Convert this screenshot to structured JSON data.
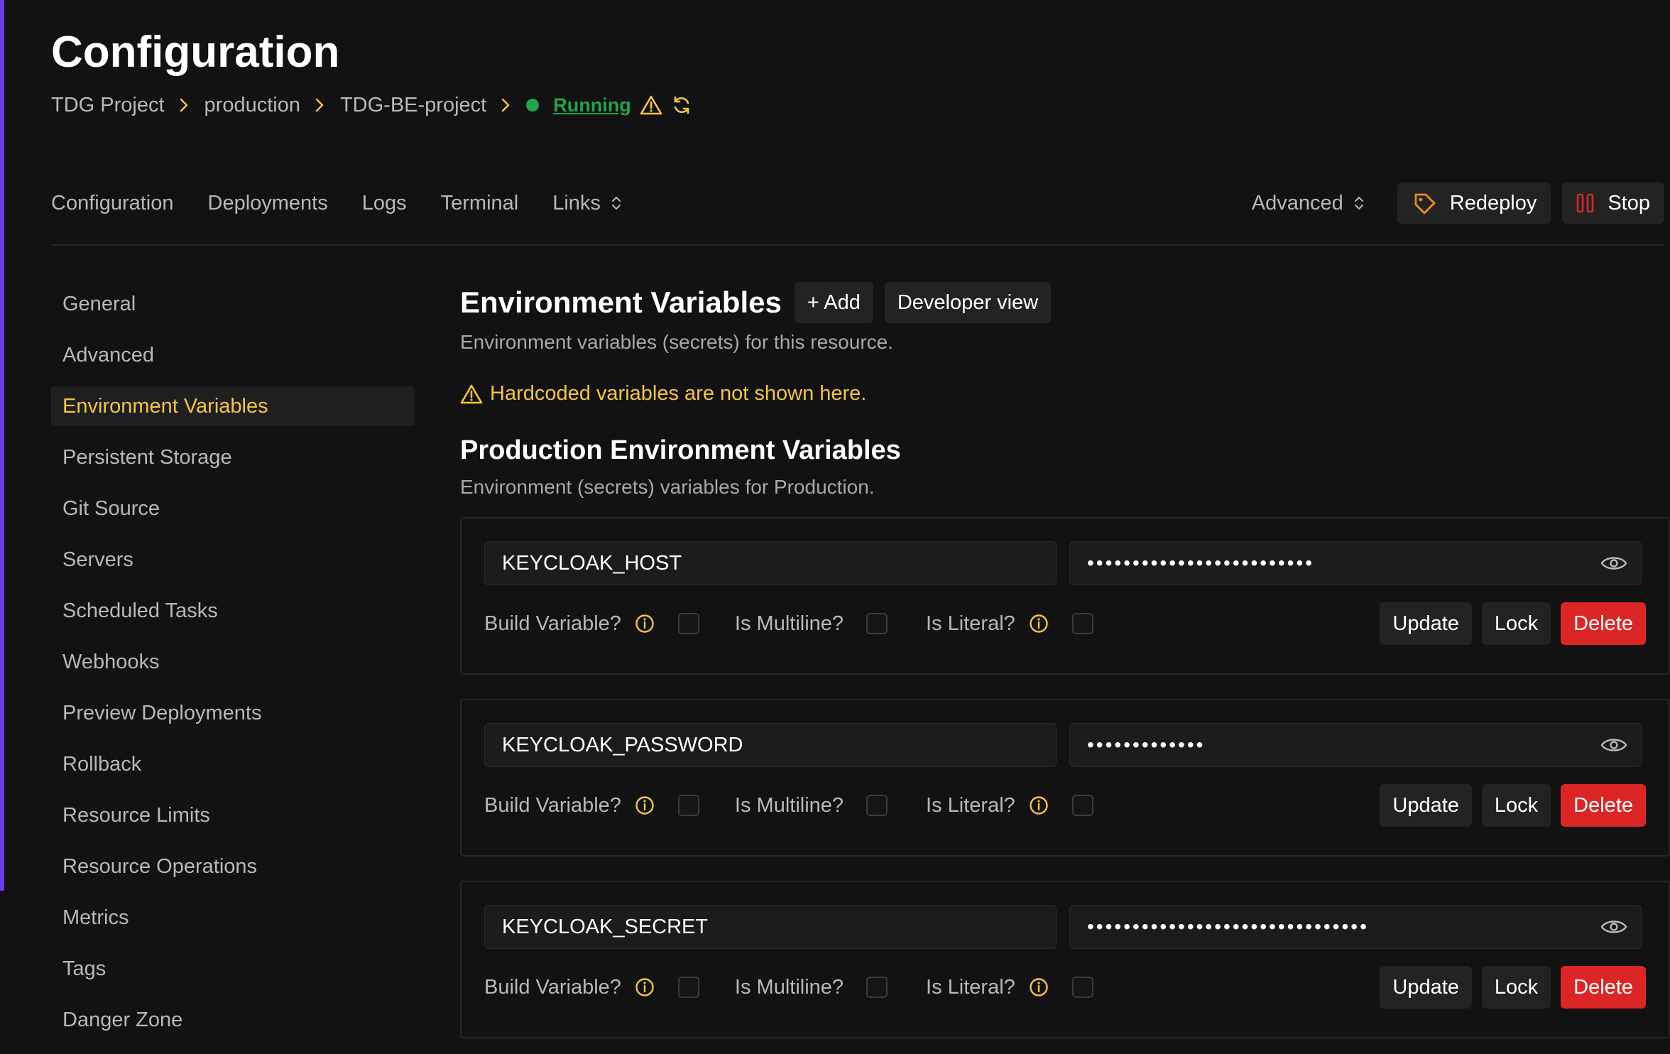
{
  "page": {
    "title": "Configuration",
    "breadcrumb": [
      "TDG Project",
      "production",
      "TDG-BE-project"
    ],
    "status": "Running"
  },
  "nav": {
    "tabs": [
      "Configuration",
      "Deployments",
      "Logs",
      "Terminal",
      "Links"
    ],
    "advanced": "Advanced",
    "redeploy": "Redeploy",
    "stop": "Stop"
  },
  "sidebar": {
    "items": [
      "General",
      "Advanced",
      "Environment Variables",
      "Persistent Storage",
      "Git Source",
      "Servers",
      "Scheduled Tasks",
      "Webhooks",
      "Preview Deployments",
      "Rollback",
      "Resource Limits",
      "Resource Operations",
      "Metrics",
      "Tags",
      "Danger Zone"
    ],
    "active": "Environment Variables"
  },
  "env": {
    "title": "Environment Variables",
    "add": "+ Add",
    "developer_view": "Developer view",
    "subtitle": "Environment variables (secrets) for this resource.",
    "warning": "Hardcoded variables are not shown here.",
    "production_title": "Production Environment Variables",
    "production_subtitle": "Environment (secrets) variables for Production."
  },
  "labels": {
    "build": "Build Variable?",
    "multiline": "Is Multiline?",
    "literal": "Is Literal?",
    "update": "Update",
    "lock": "Lock",
    "delete": "Delete"
  },
  "variables": [
    {
      "key": "KEYCLOAK_HOST",
      "masked": "•••••••••••••••••••••••••",
      "build": false,
      "multiline": false,
      "literal": false
    },
    {
      "key": "KEYCLOAK_PASSWORD",
      "masked": "•••••••••••••",
      "build": false,
      "multiline": false,
      "literal": false
    },
    {
      "key": "KEYCLOAK_SECRET",
      "masked": "•••••••••••••••••••••••••••••••",
      "build": false,
      "multiline": false,
      "literal": false
    }
  ],
  "colors": {
    "accent": "#f5c542",
    "status": "#22a34a",
    "danger": "#dc2626",
    "redeploy_icon": "#f08a24",
    "sidebar_accent": "#6b3ee8"
  }
}
